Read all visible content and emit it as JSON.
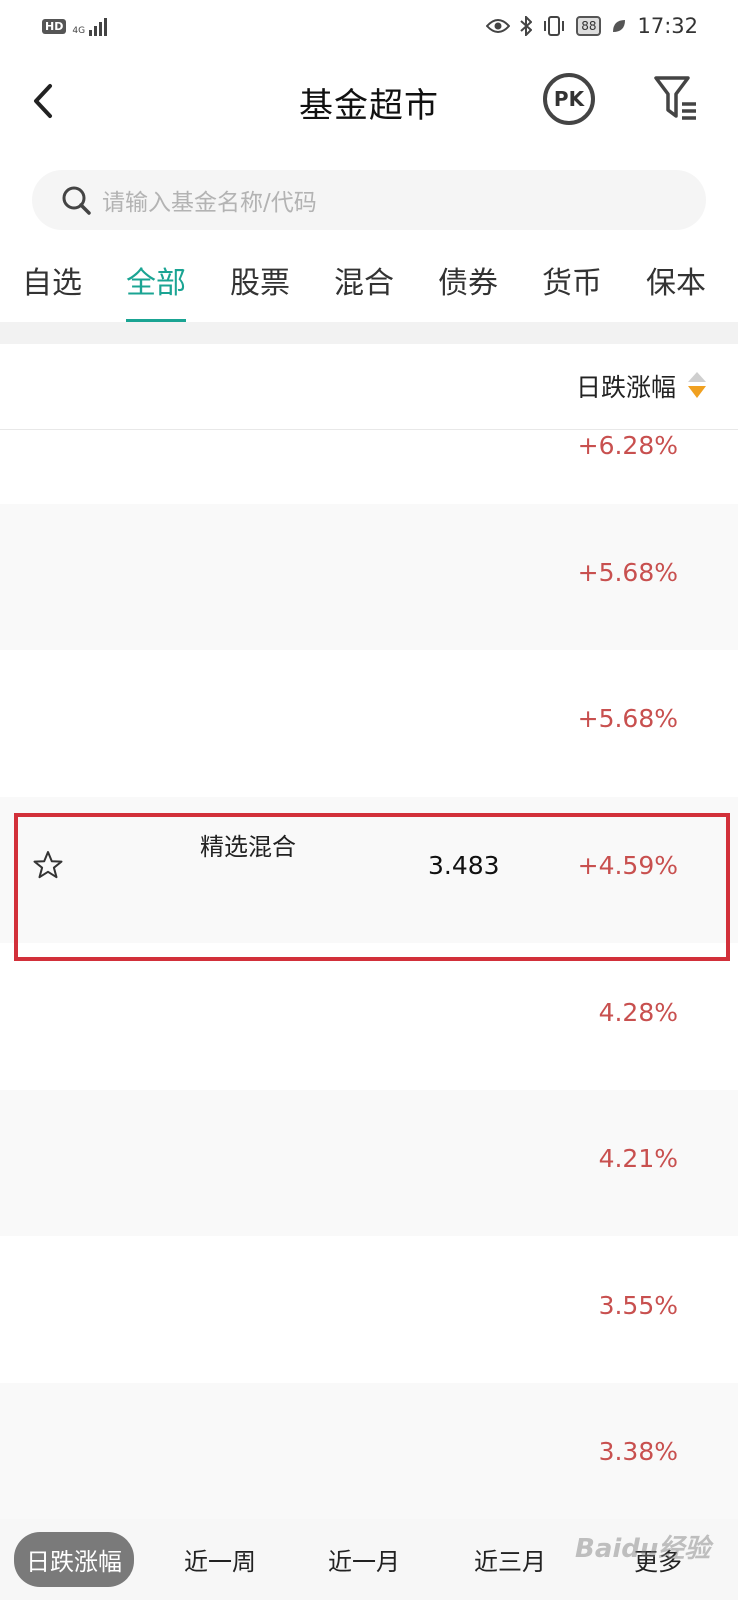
{
  "status_bar": {
    "badge": "HD",
    "network": "4G",
    "battery": "88",
    "time": "17:32"
  },
  "header": {
    "title": "基金超市",
    "pk_label": "PK"
  },
  "search": {
    "placeholder": "请输入基金名称/代码"
  },
  "tabs": [
    {
      "label": "自选",
      "active": false
    },
    {
      "label": "全部",
      "active": true
    },
    {
      "label": "股票",
      "active": false
    },
    {
      "label": "混合",
      "active": false
    },
    {
      "label": "债券",
      "active": false
    },
    {
      "label": "货币",
      "active": false
    },
    {
      "label": "保本",
      "active": false
    }
  ],
  "sort_header": {
    "label": "日跌涨幅"
  },
  "rows": [
    {
      "change": "+6.28%"
    },
    {
      "change": "+5.68%"
    },
    {
      "change": "+5.68%"
    },
    {
      "fund_name": "精选混合",
      "nav": "3.483",
      "change": "+4.59%"
    },
    {
      "change": "4.28%"
    },
    {
      "change": "4.21%"
    },
    {
      "change": "3.55%"
    },
    {
      "change": "3.38%"
    }
  ],
  "bottom_tabs": [
    {
      "label": "日跌涨幅",
      "active": true
    },
    {
      "label": "近一周",
      "active": false
    },
    {
      "label": "近一月",
      "active": false
    },
    {
      "label": "近三月",
      "active": false
    },
    {
      "label": "更多",
      "active": false
    }
  ],
  "watermark": "Baidu经验",
  "colors": {
    "accent": "#1aa493",
    "rise": "#c8504f",
    "highlight_border": "#d2303a"
  }
}
